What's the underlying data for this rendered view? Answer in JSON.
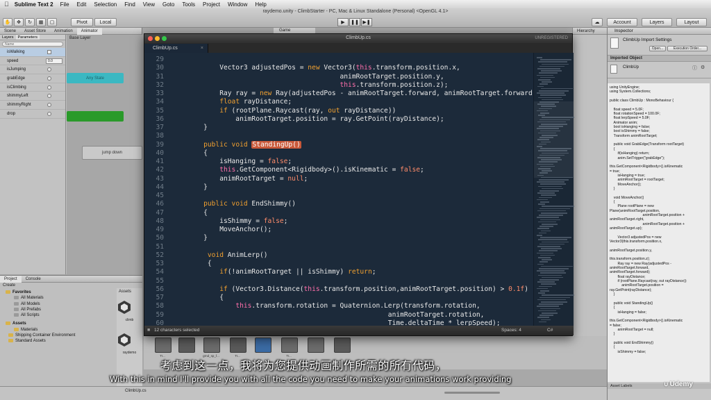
{
  "menubar": {
    "app_name": "Sublime Text 2",
    "items": [
      "File",
      "Edit",
      "Selection",
      "Find",
      "View",
      "Goto",
      "Tools",
      "Project",
      "Window",
      "Help"
    ]
  },
  "unity": {
    "window_title": "raydemo.unity - ClimbStarter - PC, Mac & Linux Standalone (Personal) <OpenGL 4.1>",
    "pivot_label": "Pivot",
    "local_label": "Local",
    "account_label": "Account",
    "layers_label": "Layers",
    "layout_label": "Layout",
    "scene_tabs": [
      "Scene",
      "Asset Store",
      "Animation",
      "Animator"
    ],
    "game_tab": "Game",
    "hierarchy_tab": "Hierarchy",
    "animator": {
      "tabs": [
        "Layers",
        "Parameters"
      ],
      "base_layer": "Base Layer",
      "search_placeholder": "Name",
      "params": [
        {
          "name": "isWalking",
          "kind": "bool"
        },
        {
          "name": "speed",
          "kind": "float",
          "value": "0.0"
        },
        {
          "name": "isJumping",
          "kind": "trigger"
        },
        {
          "name": "grabEdge",
          "kind": "trigger"
        },
        {
          "name": "isClimbing",
          "kind": "trigger"
        },
        {
          "name": "shimmyLeft",
          "kind": "trigger"
        },
        {
          "name": "shimmyRight",
          "kind": "trigger"
        },
        {
          "name": "drop",
          "kind": "trigger"
        }
      ],
      "nodes": {
        "entry": "Any State",
        "jump_down": "jump down"
      }
    },
    "project": {
      "tabs": [
        "Project",
        "Console"
      ],
      "create_label": "Create",
      "favorites_label": "Favorites",
      "favorites": [
        "All Materials",
        "All Models",
        "All Prefabs",
        "All Scripts"
      ],
      "assets_label": "Assets",
      "assets": [
        "Materials",
        "Shipping Container Environment",
        "Standard Assets"
      ],
      "assets_header": "Assets",
      "asset_items": [
        "climb",
        "raydemo"
      ],
      "footer_file": "ClimbUp.cs"
    },
    "asset_bar_labels": [
      "Tr...",
      "",
      "grnd_sp_f...",
      "Tr...",
      "",
      "Tr...",
      "",
      ""
    ],
    "inspector": {
      "tab": "Inspector",
      "title": "ClimbUp Import Settings",
      "open_button": "Open...",
      "exec_order_button": "Execution Order...",
      "imported_object": "Imported Object",
      "object_name": "ClimbUp",
      "asset_labels": "Asset Labels",
      "source": "using UnityEngine;\nusing System.Collections;\n\npublic class ClimbUp : MonoBehaviour {\n\n    float speed = 5.0F;\n    float rotationSpeed = 100.0F;\n    float lerpSpeed = 5.0F;\n    Animator anim;\n    bool isHanging = false;\n    bool isShimmy = false;\n    Transform animRootTarget;\n\n    public void GrabEdge(Transform rootTarget)\n    {\n        if(isHanging) return;\n        anim.SetTrigger(\"grabEdge\");\n\nthis.GetComponent<Rigidbody>().isKinematic\n= true;\n        isHanging = true;\n        animRootTarget = rootTarget;\n        MoveAnchor();\n    }\n\n    void MoveAnchor()\n    {\n        Plane rootPlane = new\nPlane(animRootTarget.position,\n                                 animRootTarget.position +\nanimRootTarget.right,\n                                 animRootTarget.position +\nanimRootTarget.up);\n\n        Vector3 adjustedPos = new\nVector3(this.transform.position.x,\n\nanimRootTarget.position.y,\n\nthis.transform.position.z);\n        Ray ray = new Ray(adjustedPos -\nanimRootTarget.forward,\nanimRootTarget.forward);\n        float rayDistance;\n        if (rootPlane.Raycast(ray, out rayDistance))\n            animRootTarget.position =\nray.GetPoint(rayDistance);\n    }\n\n    public void StandingUp()\n    {\n        isHanging = false;\n\nthis.GetComponent<Rigidbody>().isKinematic\n= false;\n        animRootTarget = null;\n    }\n\n    public void EndShimmy()\n    {\n        isShimmy = false;"
    }
  },
  "sublime": {
    "window_title": "ClimbUp.cs",
    "unregistered": "UNREGISTERED",
    "tab_label": "ClimbUp.cs",
    "status_left": "12 characters selected",
    "status_spaces": "Spaces: 4",
    "status_lang": "C#",
    "lines": [
      {
        "n": "29",
        "segs": [
          {
            "t": ""
          }
        ]
      },
      {
        "n": "30",
        "segs": [
          {
            "t": "        Vector3 adjustedPos = "
          },
          {
            "t": "new",
            "c": "kw"
          },
          {
            "t": " Vector3("
          },
          {
            "t": "this",
            "c": "th"
          },
          {
            "t": ".transform.position.x,"
          }
        ]
      },
      {
        "n": "31",
        "segs": [
          {
            "t": "                                      animRootTarget.position.y,"
          }
        ]
      },
      {
        "n": "32",
        "segs": [
          {
            "t": "                                      "
          },
          {
            "t": "this",
            "c": "th"
          },
          {
            "t": ".transform.position.z);"
          }
        ]
      },
      {
        "n": "33",
        "segs": [
          {
            "t": "        Ray ray = "
          },
          {
            "t": "new",
            "c": "kw"
          },
          {
            "t": " Ray(adjustedPos - animRootTarget.forward, animRootTarget.forward);"
          }
        ]
      },
      {
        "n": "34",
        "segs": [
          {
            "t": "        "
          },
          {
            "t": "float",
            "c": "kw"
          },
          {
            "t": " rayDistance;"
          }
        ]
      },
      {
        "n": "35",
        "segs": [
          {
            "t": "        "
          },
          {
            "t": "if",
            "c": "kw"
          },
          {
            "t": " (rootPlane.Raycast(ray, "
          },
          {
            "t": "out",
            "c": "kw"
          },
          {
            "t": " rayDistance))"
          }
        ]
      },
      {
        "n": "36",
        "segs": [
          {
            "t": "            animRootTarget.position = ray.GetPoint(rayDistance);"
          }
        ]
      },
      {
        "n": "37",
        "segs": [
          {
            "t": "    }"
          }
        ]
      },
      {
        "n": "38",
        "segs": [
          {
            "t": ""
          }
        ]
      },
      {
        "n": "39",
        "segs": [
          {
            "t": "    "
          },
          {
            "t": "public",
            "c": "kw"
          },
          {
            "t": " "
          },
          {
            "t": "void",
            "c": "kw"
          },
          {
            "t": " "
          },
          {
            "t": "StandingUp()",
            "c": "hl"
          }
        ]
      },
      {
        "n": "40",
        "segs": [
          {
            "t": "    {"
          }
        ]
      },
      {
        "n": "41",
        "segs": [
          {
            "t": "        isHanging = "
          },
          {
            "t": "false",
            "c": "nm"
          },
          {
            "t": ";"
          }
        ]
      },
      {
        "n": "42",
        "segs": [
          {
            "t": "        "
          },
          {
            "t": "this",
            "c": "th"
          },
          {
            "t": ".GetComponent<Rigidbody>().isKinematic = "
          },
          {
            "t": "false",
            "c": "nm"
          },
          {
            "t": ";"
          }
        ]
      },
      {
        "n": "43",
        "segs": [
          {
            "t": "        animRootTarget = "
          },
          {
            "t": "null",
            "c": "nm"
          },
          {
            "t": ";"
          }
        ]
      },
      {
        "n": "44",
        "segs": [
          {
            "t": "    }"
          }
        ]
      },
      {
        "n": "45",
        "segs": [
          {
            "t": ""
          }
        ]
      },
      {
        "n": "46",
        "segs": [
          {
            "t": "    "
          },
          {
            "t": "public",
            "c": "kw"
          },
          {
            "t": " "
          },
          {
            "t": "void",
            "c": "kw"
          },
          {
            "t": " EndShimmy()"
          }
        ]
      },
      {
        "n": "47",
        "segs": [
          {
            "t": "    {"
          }
        ]
      },
      {
        "n": "48",
        "segs": [
          {
            "t": "        isShimmy = "
          },
          {
            "t": "false",
            "c": "nm"
          },
          {
            "t": ";"
          }
        ]
      },
      {
        "n": "49",
        "segs": [
          {
            "t": "        MoveAnchor();"
          }
        ]
      },
      {
        "n": "50",
        "segs": [
          {
            "t": "    }"
          }
        ]
      },
      {
        "n": "51",
        "segs": [
          {
            "t": ""
          }
        ]
      },
      {
        "n": "52",
        "segs": [
          {
            "t": "     "
          },
          {
            "t": "void",
            "c": "kw"
          },
          {
            "t": " AnimLerp()"
          }
        ]
      },
      {
        "n": "53",
        "segs": [
          {
            "t": "     {"
          }
        ]
      },
      {
        "n": "54",
        "segs": [
          {
            "t": "        "
          },
          {
            "t": "if",
            "c": "kw"
          },
          {
            "t": "(!animRootTarget || isShimmy) "
          },
          {
            "t": "return",
            "c": "kw"
          },
          {
            "t": ";"
          }
        ]
      },
      {
        "n": "55",
        "segs": [
          {
            "t": ""
          }
        ]
      },
      {
        "n": "56",
        "segs": [
          {
            "t": "        "
          },
          {
            "t": "if",
            "c": "kw"
          },
          {
            "t": " (Vector3.Distance("
          },
          {
            "t": "this",
            "c": "th"
          },
          {
            "t": ".transform.position,animRootTarget.position) > "
          },
          {
            "t": "0.1f",
            "c": "nm"
          },
          {
            "t": ")"
          }
        ]
      },
      {
        "n": "57",
        "segs": [
          {
            "t": "        {"
          }
        ]
      },
      {
        "n": "58",
        "segs": [
          {
            "t": "            "
          },
          {
            "t": "this",
            "c": "th"
          },
          {
            "t": ".transform.rotation = Quaternion.Lerp(transform.rotation,"
          }
        ]
      },
      {
        "n": "59",
        "segs": [
          {
            "t": "                                                  animRootTarget.rotation,"
          }
        ]
      },
      {
        "n": "60",
        "segs": [
          {
            "t": "                                                  Time.deltaTime * lerpSpeed);"
          }
        ]
      }
    ]
  },
  "subtitles": {
    "zh": "考虑到这一点，我将为您提供动画制作所需的所有代码，",
    "en": "With this in mind I'll provide you with all the code you need to make your animations work providing"
  },
  "watermark": "Udemy",
  "colors": {
    "editor_bg": "#1c2a3a",
    "keyword": "#f0a030",
    "this_kw": "#ff6fab",
    "literal": "#ff8c6a",
    "selection": "#c9593a"
  }
}
